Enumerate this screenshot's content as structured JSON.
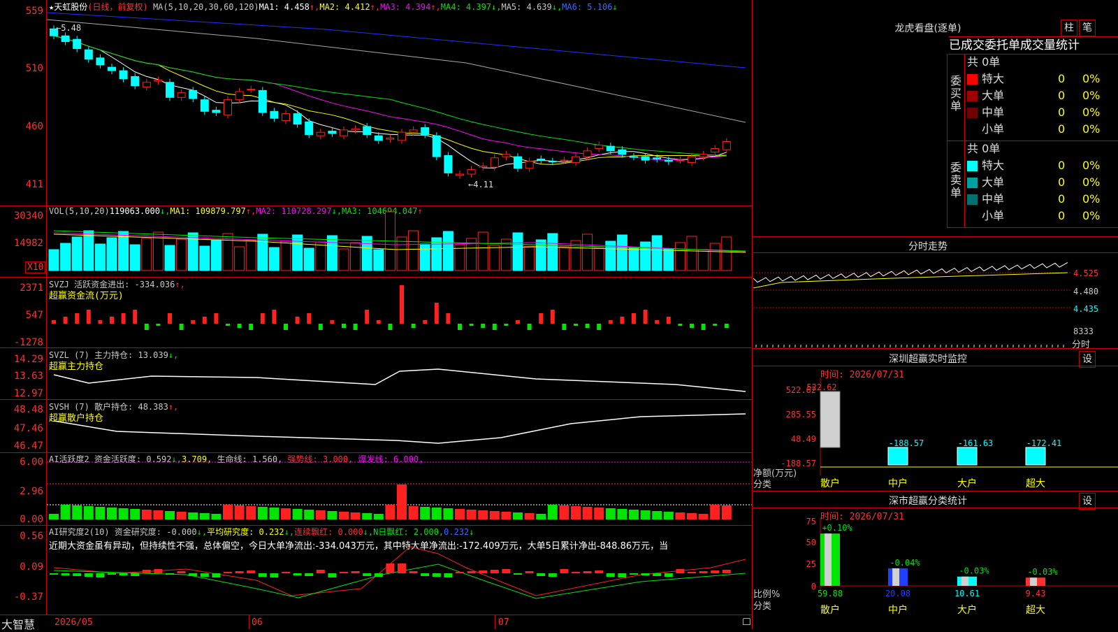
{
  "app": {
    "name": "大智慧",
    "stock": "天虹股份",
    "mode": "(日线，前复权)"
  },
  "kline": {
    "ma_header": [
      {
        "t": "MA(5,10,20,30,60,120)",
        "c": "#c8c8c8"
      },
      {
        "t": "MA1: 4.458",
        "c": "#ffffff"
      },
      {
        "t": "↑,",
        "c": "#ff3030"
      },
      {
        "t": "MA2: 4.412",
        "c": "#ffff00"
      },
      {
        "t": "↑,",
        "c": "#ff3030"
      },
      {
        "t": "MA3: 4.394",
        "c": "#ff00ff"
      },
      {
        "t": "↑,",
        "c": "#ff3030"
      },
      {
        "t": "MA4: 4.397",
        "c": "#00e600"
      },
      {
        "t": "↓,",
        "c": "#00e600"
      },
      {
        "t": "MA5: 4.639",
        "c": "#c8c8c8"
      },
      {
        "t": "↓,",
        "c": "#00e600"
      },
      {
        "t": "MA6: 5.106",
        "c": "#3b6bff"
      },
      {
        "t": "↓",
        "c": "#00e600"
      }
    ],
    "yticks": [
      "559",
      "510",
      "460",
      "411"
    ],
    "high_label": "←5.48",
    "low_label": "←4.11",
    "closes": [
      5.39,
      5.34,
      5.28,
      5.19,
      5.14,
      5.09,
      5.02,
      4.96,
      4.99,
      5.01,
      4.86,
      4.9,
      4.85,
      4.74,
      4.73,
      4.84,
      4.91,
      4.93,
      4.73,
      4.68,
      4.72,
      4.63,
      4.54,
      4.56,
      4.55,
      4.58,
      4.59,
      4.54,
      4.49,
      4.51,
      4.56,
      4.58,
      4.54,
      4.35,
      4.21,
      4.2,
      4.24,
      4.27,
      4.34,
      4.37,
      4.25,
      4.31,
      4.32,
      4.31,
      4.32,
      4.35,
      4.4,
      4.45,
      4.4,
      4.37,
      4.35,
      4.32,
      4.33,
      4.31,
      4.32,
      4.35,
      4.37,
      4.42,
      4.48
    ]
  },
  "vol": {
    "header": [
      {
        "t": "VOL(5,10,20)",
        "c": "#c8c8c8"
      },
      {
        "t": "119063.000",
        "c": "#ffffff"
      },
      {
        "t": "↓,",
        "c": "#00e600"
      },
      {
        "t": "MA1: 109879.797",
        "c": "#ffff00"
      },
      {
        "t": "↑,",
        "c": "#ff3030"
      },
      {
        "t": "MA2: 110728.297",
        "c": "#ff00ff"
      },
      {
        "t": "↓,",
        "c": "#00e600"
      },
      {
        "t": "MA3: 104694.047",
        "c": "#00e600"
      },
      {
        "t": "↑",
        "c": "#ff3030"
      }
    ],
    "yticks": [
      "30340",
      "14982"
    ],
    "unit": "X10"
  },
  "svzj": {
    "header": [
      {
        "t": "SVZJ  活跃资金进出: -334.036",
        "c": "#c8c8c8"
      },
      {
        "t": "↑,",
        "c": "#ff3030"
      }
    ],
    "sub": "超赢资金流(万元)",
    "yticks": [
      "2371",
      "547",
      "-1278"
    ]
  },
  "svzl": {
    "header": [
      {
        "t": "SVZL (7) 主力持仓: 13.039",
        "c": "#c8c8c8"
      },
      {
        "t": "↓,",
        "c": "#00e600"
      }
    ],
    "sub": "超赢主力持仓",
    "yticks": [
      "14.29",
      "13.63",
      "12.97"
    ]
  },
  "svsh": {
    "header": [
      {
        "t": "SVSH (7) 散户持仓: 48.383",
        "c": "#c8c8c8"
      },
      {
        "t": "↑,",
        "c": "#ff3030"
      }
    ],
    "sub": "超赢散户持仓",
    "yticks": [
      "48.48",
      "47.46",
      "46.47"
    ]
  },
  "ai1": {
    "header": [
      {
        "t": "AI活跃度2 资金活跃度: 0.592",
        "c": "#c8c8c8"
      },
      {
        "t": "↓,",
        "c": "#00e600"
      },
      {
        "t": "3.709,",
        "c": "#ffff00"
      },
      {
        "t": " 生命线: 1.560,",
        "c": "#c8c8c8"
      },
      {
        "t": " 强势线: 3.000,",
        "c": "#ff3030"
      },
      {
        "t": " 爆发线: 6.000,",
        "c": "#ff00ff"
      }
    ],
    "yticks": [
      "6.00",
      "2.96",
      "0.00"
    ]
  },
  "ai2": {
    "header": [
      {
        "t": "AI研究度2(10) 资金研究度: -0.000",
        "c": "#c8c8c8"
      },
      {
        "t": "↓,",
        "c": "#00e600"
      },
      {
        "t": "平均研究度: 0.232",
        "c": "#ffff00"
      },
      {
        "t": "↓,",
        "c": "#00e600"
      },
      {
        "t": "连续飘红: 0.000",
        "c": "#ff3030"
      },
      {
        "t": "↓,",
        "c": "#00e600"
      },
      {
        "t": "N日飘红: 2.000,",
        "c": "#00e600"
      },
      {
        "t": "0.232",
        "c": "#3b6bff"
      },
      {
        "t": "↓",
        "c": "#00e600"
      }
    ],
    "note": "近期大资金虽有异动，但持续性不强，总体偏空，今日大单净流出:-334.043万元，其中特大单净流出:-172.409万元，大单5日累计净出-848.86万元，当",
    "yticks": [
      "0.56",
      "0.09",
      "-0.37"
    ]
  },
  "xaxis": [
    "2026/05",
    "06",
    "07"
  ],
  "longhu": {
    "title": "龙虎看盘(逐单)",
    "btn1": "柱",
    "btn2": "笔",
    "subtitle": "已成交委托单成交量统计",
    "buy": {
      "label": "委买单",
      "total": "共 0单",
      "rows": [
        {
          "n": "特大",
          "v": "0",
          "p": "0%",
          "c": "#ff0000"
        },
        {
          "n": "大单",
          "v": "0",
          "p": "0%",
          "c": "#a00000"
        },
        {
          "n": "中单",
          "v": "0",
          "p": "0%",
          "c": "#700000"
        },
        {
          "n": "小单",
          "v": "0",
          "p": "0%",
          "c": "#000000"
        }
      ]
    },
    "sell": {
      "label": "委卖单",
      "total": "共 0单",
      "rows": [
        {
          "n": "特大",
          "v": "0",
          "p": "0%",
          "c": "#00ffff"
        },
        {
          "n": "大单",
          "v": "0",
          "p": "0%",
          "c": "#00a0a0"
        },
        {
          "n": "中单",
          "v": "0",
          "p": "0%",
          "c": "#007070"
        },
        {
          "n": "小单",
          "v": "0",
          "p": "0%",
          "c": "#000000"
        }
      ]
    }
  },
  "intraday": {
    "title": "分时走势",
    "yticks": [
      "4.525",
      "4.480",
      "4.435"
    ],
    "vol": "8333",
    "vol_unit": "分时"
  },
  "monitor": {
    "title": "深圳超赢实时监控",
    "btn": "设",
    "time": "时间: 2026/07/31",
    "yticks": [
      "522.62",
      "285.55",
      "48.49",
      "-188.57"
    ],
    "ylabel": "净额(万元)",
    "xlabel": "分类",
    "cats": [
      "散户",
      "中户",
      "大户",
      "超大"
    ],
    "values": [
      "522.62",
      "-188.57",
      "-161.63",
      "-172.41"
    ]
  },
  "classify": {
    "title": "深市超赢分类统计",
    "btn": "设",
    "time": "时间: 2026/07/31",
    "yticks": [
      "75",
      "50",
      "25",
      "0"
    ],
    "ylabel": "比例%",
    "xlabel": "分类",
    "cats": [
      "散户",
      "中户",
      "大户",
      "超大"
    ],
    "tops": [
      "+0.10%",
      "-0.04%",
      "-0.03%",
      "-0.03%"
    ],
    "values": [
      "59.88",
      "20.08",
      "10.61",
      "9.43"
    ]
  }
}
